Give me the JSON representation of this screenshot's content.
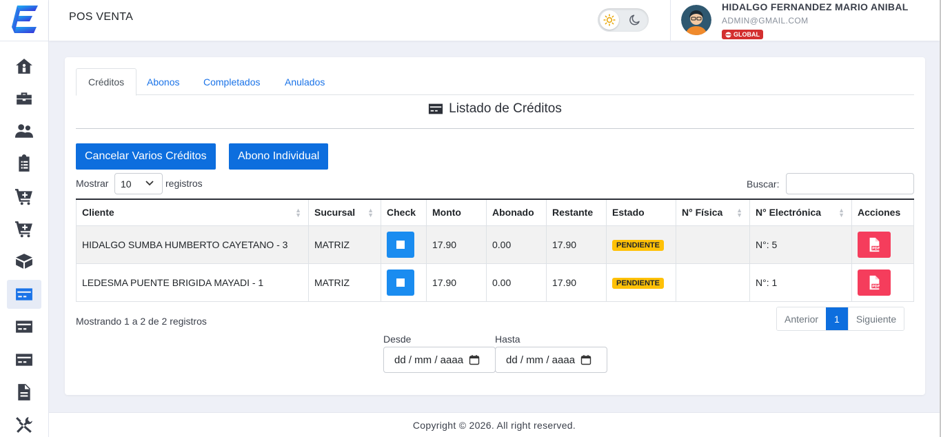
{
  "header": {
    "title": "POS VENTA",
    "user_name": "HIDALGO FERNANDEZ MARIO ANIBAL",
    "user_email": "ADMIN@GMAIL.COM",
    "badge": "GLOBAL"
  },
  "sidebar": {
    "items": [
      {
        "icon": "home-icon"
      },
      {
        "icon": "briefcase-icon"
      },
      {
        "icon": "users-icon"
      },
      {
        "icon": "clipboard-list-icon"
      },
      {
        "icon": "cart-plus-icon"
      },
      {
        "icon": "cart-plus-icon"
      },
      {
        "icon": "box-icon"
      },
      {
        "icon": "credit-card-icon",
        "active": true
      },
      {
        "icon": "credit-card-icon"
      },
      {
        "icon": "credit-card-icon"
      },
      {
        "icon": "file-icon"
      },
      {
        "icon": "tools-icon"
      }
    ]
  },
  "tabs": [
    {
      "label": "Créditos",
      "active": true
    },
    {
      "label": "Abonos"
    },
    {
      "label": "Completados"
    },
    {
      "label": "Anulados"
    }
  ],
  "list_title": "Listado de Créditos",
  "buttons": {
    "cancel_many": "Cancelar Varios Créditos",
    "single_payment": "Abono Individual"
  },
  "table_controls": {
    "show_label": "Mostrar",
    "page_size": "10",
    "records_label": "registros",
    "search_label": "Buscar:"
  },
  "table": {
    "columns": [
      "Cliente",
      "Sucursal",
      "Check",
      "Monto",
      "Abonado",
      "Restante",
      "Estado",
      "N° Física",
      "N° Electrónica",
      "Acciones"
    ],
    "rows": [
      {
        "cliente": "HIDALGO SUMBA HUMBERTO CAYETANO - 3",
        "sucursal": "MATRIZ",
        "monto": "17.90",
        "abonado": "0.00",
        "restante": "17.90",
        "estado": "PENDIENTE",
        "fisica": "",
        "electronica": "N°: 5"
      },
      {
        "cliente": "LEDESMA PUENTE BRIGIDA MAYADI - 1",
        "sucursal": "MATRIZ",
        "monto": "17.90",
        "abonado": "0.00",
        "restante": "17.90",
        "estado": "PENDIENTE",
        "fisica": "",
        "electronica": "N°: 1"
      }
    ]
  },
  "pagination": {
    "info": "Mostrando 1 a 2 de 2 registros",
    "prev": "Anterior",
    "current": "1",
    "next": "Siguiente"
  },
  "dates": {
    "from_label": "Desde",
    "to_label": "Hasta",
    "placeholder": "dd / mm / aaaa"
  },
  "footer": "Copyright © 2026. All right reserved.",
  "colors": {
    "primary": "#0d6ede",
    "danger": "#f53d5c",
    "warning": "#ffc107",
    "badge": "#d32f2f"
  }
}
